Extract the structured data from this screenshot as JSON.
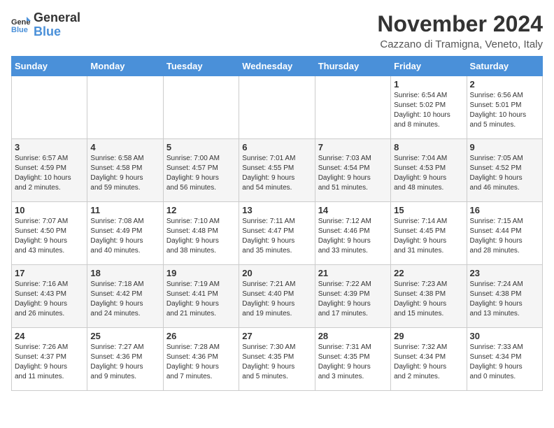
{
  "header": {
    "logo_line1": "General",
    "logo_line2": "Blue",
    "month_title": "November 2024",
    "location": "Cazzano di Tramigna, Veneto, Italy"
  },
  "weekdays": [
    "Sunday",
    "Monday",
    "Tuesday",
    "Wednesday",
    "Thursday",
    "Friday",
    "Saturday"
  ],
  "weeks": [
    [
      {
        "day": "",
        "info": ""
      },
      {
        "day": "",
        "info": ""
      },
      {
        "day": "",
        "info": ""
      },
      {
        "day": "",
        "info": ""
      },
      {
        "day": "",
        "info": ""
      },
      {
        "day": "1",
        "info": "Sunrise: 6:54 AM\nSunset: 5:02 PM\nDaylight: 10 hours\nand 8 minutes."
      },
      {
        "day": "2",
        "info": "Sunrise: 6:56 AM\nSunset: 5:01 PM\nDaylight: 10 hours\nand 5 minutes."
      }
    ],
    [
      {
        "day": "3",
        "info": "Sunrise: 6:57 AM\nSunset: 4:59 PM\nDaylight: 10 hours\nand 2 minutes."
      },
      {
        "day": "4",
        "info": "Sunrise: 6:58 AM\nSunset: 4:58 PM\nDaylight: 9 hours\nand 59 minutes."
      },
      {
        "day": "5",
        "info": "Sunrise: 7:00 AM\nSunset: 4:57 PM\nDaylight: 9 hours\nand 56 minutes."
      },
      {
        "day": "6",
        "info": "Sunrise: 7:01 AM\nSunset: 4:55 PM\nDaylight: 9 hours\nand 54 minutes."
      },
      {
        "day": "7",
        "info": "Sunrise: 7:03 AM\nSunset: 4:54 PM\nDaylight: 9 hours\nand 51 minutes."
      },
      {
        "day": "8",
        "info": "Sunrise: 7:04 AM\nSunset: 4:53 PM\nDaylight: 9 hours\nand 48 minutes."
      },
      {
        "day": "9",
        "info": "Sunrise: 7:05 AM\nSunset: 4:52 PM\nDaylight: 9 hours\nand 46 minutes."
      }
    ],
    [
      {
        "day": "10",
        "info": "Sunrise: 7:07 AM\nSunset: 4:50 PM\nDaylight: 9 hours\nand 43 minutes."
      },
      {
        "day": "11",
        "info": "Sunrise: 7:08 AM\nSunset: 4:49 PM\nDaylight: 9 hours\nand 40 minutes."
      },
      {
        "day": "12",
        "info": "Sunrise: 7:10 AM\nSunset: 4:48 PM\nDaylight: 9 hours\nand 38 minutes."
      },
      {
        "day": "13",
        "info": "Sunrise: 7:11 AM\nSunset: 4:47 PM\nDaylight: 9 hours\nand 35 minutes."
      },
      {
        "day": "14",
        "info": "Sunrise: 7:12 AM\nSunset: 4:46 PM\nDaylight: 9 hours\nand 33 minutes."
      },
      {
        "day": "15",
        "info": "Sunrise: 7:14 AM\nSunset: 4:45 PM\nDaylight: 9 hours\nand 31 minutes."
      },
      {
        "day": "16",
        "info": "Sunrise: 7:15 AM\nSunset: 4:44 PM\nDaylight: 9 hours\nand 28 minutes."
      }
    ],
    [
      {
        "day": "17",
        "info": "Sunrise: 7:16 AM\nSunset: 4:43 PM\nDaylight: 9 hours\nand 26 minutes."
      },
      {
        "day": "18",
        "info": "Sunrise: 7:18 AM\nSunset: 4:42 PM\nDaylight: 9 hours\nand 24 minutes."
      },
      {
        "day": "19",
        "info": "Sunrise: 7:19 AM\nSunset: 4:41 PM\nDaylight: 9 hours\nand 21 minutes."
      },
      {
        "day": "20",
        "info": "Sunrise: 7:21 AM\nSunset: 4:40 PM\nDaylight: 9 hours\nand 19 minutes."
      },
      {
        "day": "21",
        "info": "Sunrise: 7:22 AM\nSunset: 4:39 PM\nDaylight: 9 hours\nand 17 minutes."
      },
      {
        "day": "22",
        "info": "Sunrise: 7:23 AM\nSunset: 4:38 PM\nDaylight: 9 hours\nand 15 minutes."
      },
      {
        "day": "23",
        "info": "Sunrise: 7:24 AM\nSunset: 4:38 PM\nDaylight: 9 hours\nand 13 minutes."
      }
    ],
    [
      {
        "day": "24",
        "info": "Sunrise: 7:26 AM\nSunset: 4:37 PM\nDaylight: 9 hours\nand 11 minutes."
      },
      {
        "day": "25",
        "info": "Sunrise: 7:27 AM\nSunset: 4:36 PM\nDaylight: 9 hours\nand 9 minutes."
      },
      {
        "day": "26",
        "info": "Sunrise: 7:28 AM\nSunset: 4:36 PM\nDaylight: 9 hours\nand 7 minutes."
      },
      {
        "day": "27",
        "info": "Sunrise: 7:30 AM\nSunset: 4:35 PM\nDaylight: 9 hours\nand 5 minutes."
      },
      {
        "day": "28",
        "info": "Sunrise: 7:31 AM\nSunset: 4:35 PM\nDaylight: 9 hours\nand 3 minutes."
      },
      {
        "day": "29",
        "info": "Sunrise: 7:32 AM\nSunset: 4:34 PM\nDaylight: 9 hours\nand 2 minutes."
      },
      {
        "day": "30",
        "info": "Sunrise: 7:33 AM\nSunset: 4:34 PM\nDaylight: 9 hours\nand 0 minutes."
      }
    ]
  ]
}
